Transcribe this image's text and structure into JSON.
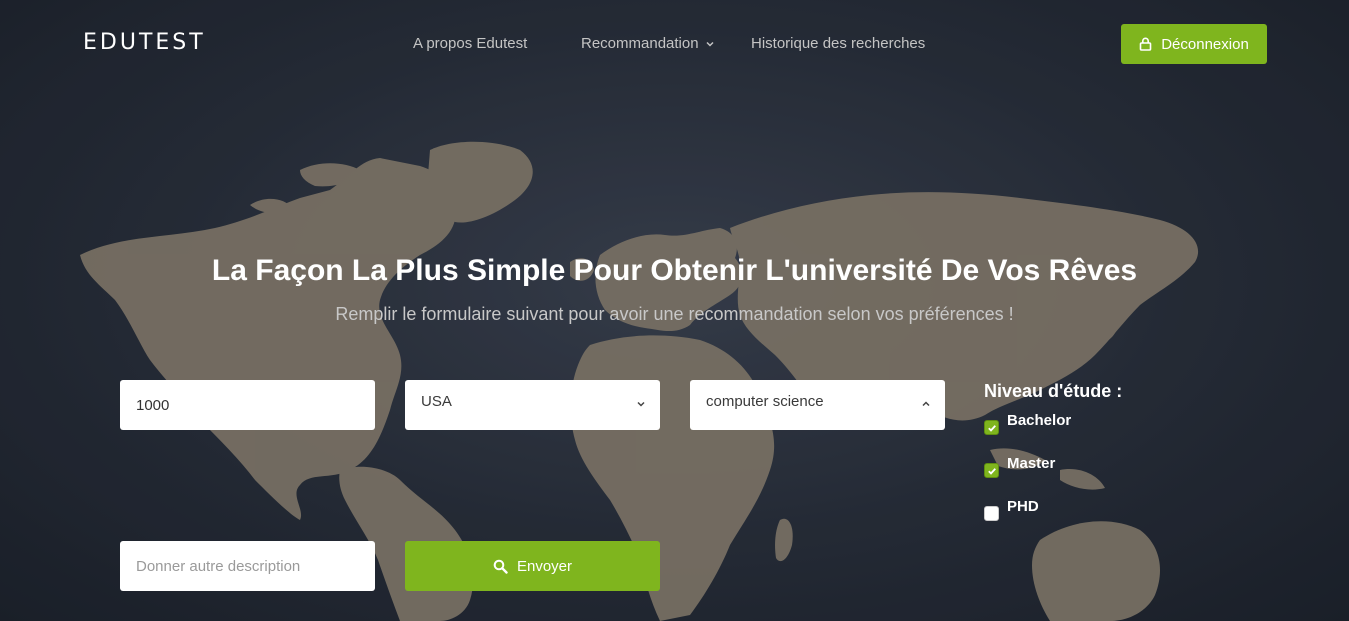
{
  "brand": "EDUTEST",
  "nav": {
    "about": "A propos Edutest",
    "recommendation": "Recommandation",
    "history": "Historique des recherches"
  },
  "header": {
    "logout_label": "Déconnexion"
  },
  "hero": {
    "title": "La Façon La Plus Simple Pour Obtenir L'université De Vos Rêves",
    "subtitle": "Remplir le formulaire suivant pour avoir une recommandation selon vos préférences !"
  },
  "form": {
    "budget_value": "1000",
    "country_value": "USA",
    "field_value": "computer science",
    "description_placeholder": "Donner autre description",
    "submit_label": "Envoyer"
  },
  "study_level": {
    "title": "Niveau d'étude :",
    "options": [
      {
        "label": "Bachelor",
        "checked": true
      },
      {
        "label": "Master",
        "checked": true
      },
      {
        "label": "PHD",
        "checked": false
      }
    ]
  },
  "colors": {
    "accent": "#7fb51e",
    "map_land": "#8a8070",
    "background": "#262c38"
  },
  "icons": {
    "logout": "lock-icon",
    "submit": "search-icon",
    "nav_dropdown": "chevron-down-icon",
    "country_select": "chevron-down-icon",
    "field_select": "chevron-up-icon"
  }
}
